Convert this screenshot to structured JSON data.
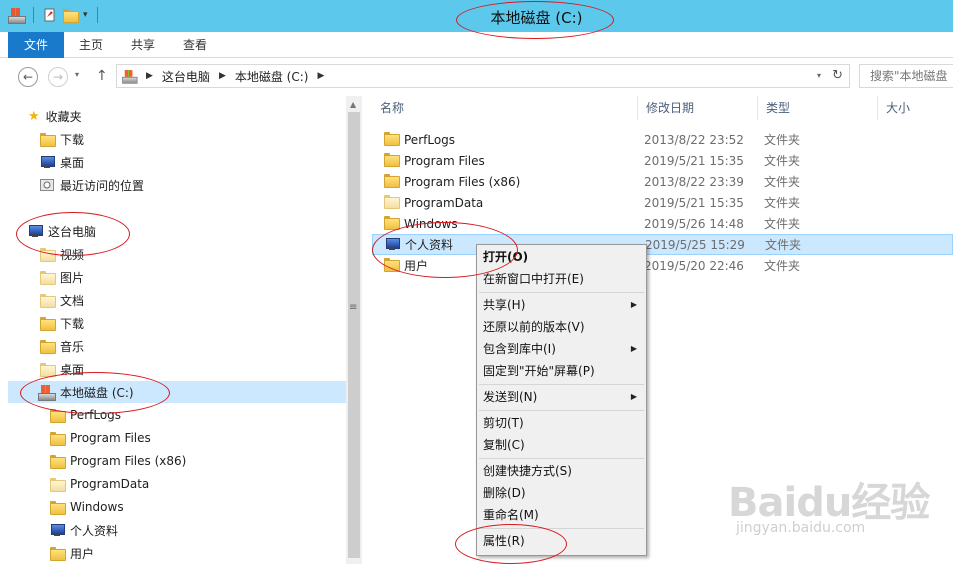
{
  "window": {
    "title": "本地磁盘 (C:)"
  },
  "ribbon": {
    "tabs": [
      "文件",
      "主页",
      "共享",
      "查看"
    ]
  },
  "address": {
    "crumbs": [
      "这台电脑",
      "本地磁盘 (C:)"
    ],
    "search_placeholder": "搜索\"本地磁盘"
  },
  "nav": {
    "favorites": {
      "label": "收藏夹",
      "items": [
        "下载",
        "桌面",
        "最近访问的位置"
      ]
    },
    "this_pc": {
      "label": "这台电脑",
      "items": [
        "视频",
        "图片",
        "文档",
        "下载",
        "音乐",
        "桌面"
      ]
    },
    "drive": {
      "label": "本地磁盘 (C:)",
      "items": [
        "PerfLogs",
        "Program Files",
        "Program Files (x86)",
        "ProgramData",
        "Windows",
        "个人资料",
        "用户"
      ]
    }
  },
  "columns": [
    "名称",
    "修改日期",
    "类型",
    "大小"
  ],
  "files": [
    {
      "name": "PerfLogs",
      "date": "2013/8/22 23:52",
      "type": "文件夹"
    },
    {
      "name": "Program Files",
      "date": "2019/5/21 15:35",
      "type": "文件夹"
    },
    {
      "name": "Program Files (x86)",
      "date": "2013/8/22 23:39",
      "type": "文件夹"
    },
    {
      "name": "ProgramData",
      "date": "2019/5/21 15:35",
      "type": "文件夹"
    },
    {
      "name": "Windows",
      "date": "2019/5/26 14:48",
      "type": "文件夹"
    },
    {
      "name": "个人资料",
      "date": "2019/5/25 15:29",
      "type": "文件夹"
    },
    {
      "name": "用户",
      "date": "2019/5/20 22:46",
      "type": "文件夹"
    }
  ],
  "context_menu": {
    "open": "打开(O)",
    "open_new": "在新窗口中打开(E)",
    "share": "共享(H)",
    "restore": "还原以前的版本(V)",
    "include": "包含到库中(I)",
    "pin": "固定到\"开始\"屏幕(P)",
    "send_to": "发送到(N)",
    "cut": "剪切(T)",
    "copy": "复制(C)",
    "shortcut": "创建快捷方式(S)",
    "delete": "删除(D)",
    "rename": "重命名(M)",
    "properties": "属性(R)"
  },
  "watermark": {
    "logo": "Baidu经验",
    "url": "jingyan.baidu.com"
  }
}
